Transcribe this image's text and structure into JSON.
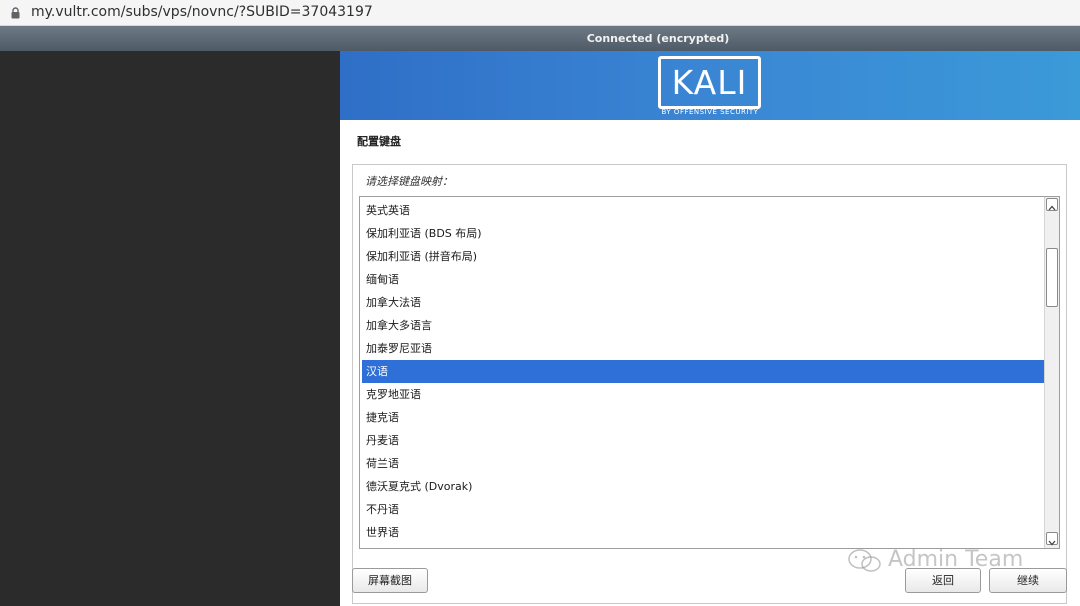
{
  "browser": {
    "url": "my.vultr.com/subs/vps/novnc/?SUBID=37043197"
  },
  "vnc": {
    "status": "Connected (encrypted)"
  },
  "installer": {
    "logo_text": "KALI",
    "logo_subtitle": "BY OFFENSIVE SECURITY",
    "section_title": "配置键盘",
    "prompt": "请选择键盘映射：",
    "keymaps": [
      "英式英语",
      "保加利亚语 (BDS 布局)",
      "保加利亚语 (拼音布局)",
      "缅甸语",
      "加拿大法语",
      "加拿大多语言",
      "加泰罗尼亚语",
      "汉语",
      "克罗地亚语",
      "捷克语",
      "丹麦语",
      "荷兰语",
      "德沃夏克式 (Dvorak)",
      "不丹语",
      "世界语"
    ],
    "selected_index": 7,
    "buttons": {
      "screenshot": "屏幕截图",
      "back": "返回",
      "continue": "继续"
    }
  },
  "watermark": {
    "text": "Admin Team",
    "icon": "wechat-icon"
  },
  "colors": {
    "banner": "#3a86d4",
    "selection": "#2f6fd8",
    "status_bar": "#5d6a76"
  }
}
